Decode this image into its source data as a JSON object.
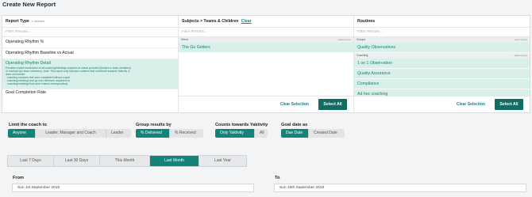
{
  "page_title": "Create New Report",
  "report_type": {
    "title": "Report Type",
    "selected_count": "1 selected",
    "filter_placeholder": "Filter Results...",
    "items": [
      "Operating Rhythm %",
      "Operating Rhythm Baseline vs Actual"
    ],
    "selected_item": {
      "title": "Operating Rhythm Detail",
      "description": [
        "Provides a table breakdown of all coaching/meetings required vs actual provided (leaders to team members)",
        "or received (by team members). Note: This report only includes numbers that contribute towards Yaktivity. It",
        "does not include:",
        "- coaching sessions that were completed without a goal.",
        "- coaching/meetings that go over minimum requirement.",
        "- coaching/meetings that were entered retrospectively"
      ]
    },
    "last_item": "Goal Completion Rate"
  },
  "subjects": {
    "title": "Subjects > Teams & Children",
    "clear_link": "Clear",
    "filter_placeholder": "Filter Results...",
    "group_label": "Direct",
    "group_select": "select group",
    "items": [
      "The Go Getters"
    ],
    "clear_selection": "Clear Selection",
    "select_all": "Select All"
  },
  "routines": {
    "title": "Routines",
    "filter_placeholder": "Filter Results...",
    "groups": [
      {
        "label": "Groups",
        "select": "select group",
        "items": [
          "Quality Observations"
        ]
      },
      {
        "label": "Coaching",
        "select": "select group",
        "items": [
          "1 on 1 Observation",
          "Quality Assurance",
          "Compliance",
          "Ad hoc coaching"
        ]
      }
    ],
    "clear_selection": "Clear Selection",
    "select_all": "Select All"
  },
  "options": {
    "limit_coach": {
      "label": "Limit the coach to",
      "buttons": [
        "Anyone",
        "Leader, Manager and Coach",
        "Leader"
      ],
      "active": "Anyone"
    },
    "group_results": {
      "label": "Group results by",
      "buttons": [
        "% Delivered",
        "% Received"
      ],
      "active": "% Delivered"
    },
    "counts": {
      "label": "Counts towards Yaktivity",
      "buttons": [
        "Only Yaktivity",
        "All"
      ],
      "active": "Only Yaktivity"
    },
    "goal_date": {
      "label": "Goal date as",
      "buttons": [
        "Due Date",
        "Created Date"
      ],
      "active": "Due Date"
    }
  },
  "date_range": {
    "buttons": [
      "Last 7 Days",
      "Last 30 Days",
      "This Month",
      "Last Month",
      "Last Year"
    ],
    "active": "Last Month"
  },
  "from": {
    "label": "From",
    "value": "Sun 1st September 2019"
  },
  "to": {
    "label": "To",
    "value": "Sun 15th September 2019"
  },
  "colors": {
    "accent": "#14847a",
    "selected_bg": "#d9efe9",
    "link": "#1a7f8e"
  }
}
